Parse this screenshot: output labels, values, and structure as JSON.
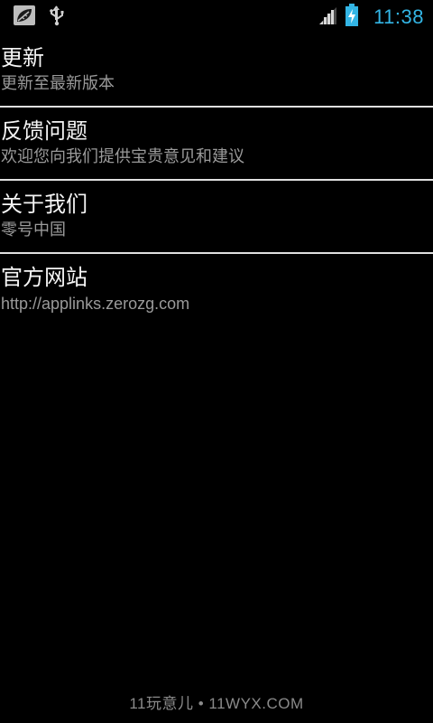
{
  "status_bar": {
    "time": "11:38",
    "icons": [
      "notification-leaf-icon",
      "usb-icon",
      "signal-icon",
      "battery-charging-icon"
    ],
    "accent_color": "#33b5e5"
  },
  "settings": {
    "items": [
      {
        "title": "更新",
        "summary": "更新至最新版本"
      },
      {
        "title": "反馈问题",
        "summary": "欢迎您向我们提供宝贵意见和建议"
      },
      {
        "title": "关于我们",
        "summary": "零号中国"
      },
      {
        "title": "官方网站",
        "summary": "http://applinks.zerozg.com"
      }
    ]
  },
  "footer": {
    "watermark": "11玩意儿 • 11WYX.COM"
  }
}
